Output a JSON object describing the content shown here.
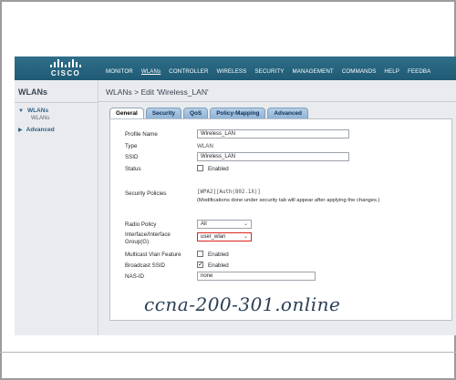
{
  "header": {
    "logo_text": "CISCO",
    "nav": [
      "MONITOR",
      "WLANs",
      "CONTROLLER",
      "WIRELESS",
      "SECURITY",
      "MANAGEMENT",
      "COMMANDS",
      "HELP",
      "FEEDBA"
    ]
  },
  "sidebar": {
    "title": "WLANs",
    "items": [
      {
        "label": "WLANs",
        "sub": "WLANs"
      },
      {
        "label": "Advanced"
      }
    ]
  },
  "main": {
    "title": "WLANs > Edit  'Wireless_LAN'",
    "tabs": [
      "General",
      "Security",
      "QoS",
      "Policy-Mapping",
      "Advanced"
    ],
    "active_tab": "General",
    "fields": {
      "profile_name": {
        "label": "Profile Name",
        "value": "Wireless_LAN"
      },
      "type": {
        "label": "Type",
        "value": "WLAN"
      },
      "ssid": {
        "label": "SSID",
        "value": "Wireless_LAN"
      },
      "status": {
        "label": "Status",
        "check_label": "Enabled",
        "checked": false
      },
      "security_policies": {
        "label": "Security Policies",
        "value": "[WPA2][Auth(802.1X)]",
        "note": "(Modifications done under security tab will appear after applying the changes.)"
      },
      "radio_policy": {
        "label": "Radio Policy",
        "value": "All"
      },
      "interface_group": {
        "label_line1": "Interface/Interface",
        "label_line2": "Group(G)",
        "value": "user_wlan"
      },
      "multicast_vlan": {
        "label": "Multicast Vlan Feature",
        "check_label": "Enabled",
        "checked": false
      },
      "broadcast_ssid": {
        "label": "Broadcast SSID",
        "check_label": "Enabled",
        "checked": true
      },
      "nas_id": {
        "label": "NAS-ID",
        "value": "none"
      }
    }
  },
  "watermark": "ccna-200-301.online",
  "colors": {
    "header": "#23617d",
    "tab": "#9dbfdf",
    "highlight": "#d9261c"
  }
}
